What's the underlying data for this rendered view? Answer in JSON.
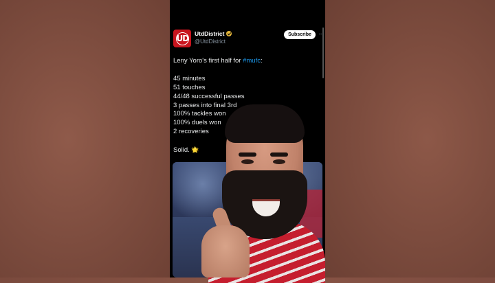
{
  "tweet": {
    "display_name": "UtdDistrict",
    "handle": "@UtdDistrict",
    "avatar_text": "UD",
    "subscribe_label": "Subscribe",
    "more_label": "···",
    "intro_prefix": "Leny Yoro's first half for ",
    "hashtag": "#mufc",
    "intro_suffix": ":",
    "stats": [
      "45 minutes",
      "51 touches",
      "44/48 successful passes",
      "3 passes into final 3rd",
      "100% tackles won",
      "100% duels won",
      "2 recoveries"
    ],
    "closing": "Solid. ",
    "closing_emoji": "🌟"
  },
  "icons": {
    "verified": "verified-badge-icon",
    "more": "more-options-icon",
    "sparkle": "sparkle-icon"
  },
  "colors": {
    "hashtag": "#1d9bf0",
    "avatar_bg": "#c8141e",
    "verified": "#e3b53a"
  }
}
